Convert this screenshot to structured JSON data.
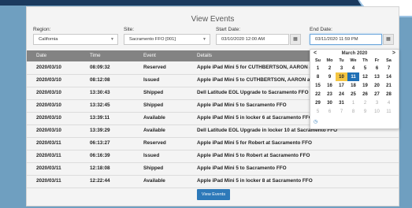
{
  "page": {
    "title": "View Events"
  },
  "filters": {
    "region_label": "Region:",
    "region_value": "California",
    "site_label": "Site:",
    "site_value": "Sacramento FFO [001]",
    "start_label": "Start Date:",
    "start_value": "03/10/2020 12:00 AM",
    "end_label": "End Date:",
    "end_value": "03/11/2020 11:59 PM"
  },
  "table": {
    "headers": [
      "Date",
      "Time",
      "Event",
      "Details"
    ],
    "rows": [
      [
        "2020/03/10",
        "08:09:32",
        "Reserved",
        "Apple iPad Mini 5 for CUTHBERTSON, AARON at Sacramento FFO"
      ],
      [
        "2020/03/10",
        "08:12:08",
        "Issued",
        "Apple iPad Mini 5 to CUTHBERTSON, AARON at Sacramento FFO"
      ],
      [
        "2020/03/10",
        "13:30:43",
        "Shipped",
        "Dell Latitude EOL Upgrade to Sacramento FFO"
      ],
      [
        "2020/03/10",
        "13:32:45",
        "Shipped",
        "Apple iPad Mini 5 to Sacramento FFO"
      ],
      [
        "2020/03/10",
        "13:39:11",
        "Available",
        "Apple iPad Mini 5 in locker 6 at Sacramento FFO"
      ],
      [
        "2020/03/10",
        "13:39:29",
        "Available",
        "Dell Latitude EOL Upgrade in locker 10 at Sacramento FFO"
      ],
      [
        "2020/03/11",
        "06:13:27",
        "Reserved",
        "Apple iPad Mini 5 for Robert at Sacramento FFO"
      ],
      [
        "2020/03/11",
        "06:16:39",
        "Issued",
        "Apple iPad Mini 5 to Robert at Sacramento FFO"
      ],
      [
        "2020/03/11",
        "12:18:08",
        "Shipped",
        "Apple iPad Mini 5 to Sacramento FFO"
      ],
      [
        "2020/03/11",
        "12:22:44",
        "Available",
        "Apple iPad Mini 5 in locker 8 at Sacramento FFO"
      ]
    ]
  },
  "calendar": {
    "month_label": "March 2020",
    "prev": "<",
    "next": ">",
    "dow": [
      "Su",
      "Mo",
      "Tu",
      "We",
      "Th",
      "Fr",
      "Sa"
    ],
    "weeks": [
      [
        "1",
        "2",
        "3",
        "4",
        "5",
        "6",
        "7"
      ],
      [
        "8",
        "9",
        "10",
        "11",
        "12",
        "13",
        "14"
      ],
      [
        "15",
        "16",
        "17",
        "18",
        "19",
        "20",
        "21"
      ],
      [
        "22",
        "23",
        "24",
        "25",
        "26",
        "27",
        "28"
      ],
      [
        "29",
        "30",
        "31",
        "1",
        "2",
        "3",
        "4"
      ],
      [
        "5",
        "6",
        "7",
        "8",
        "9",
        "10",
        "11"
      ]
    ],
    "selected_day": "11",
    "today_day": "10",
    "clock_icon": "clock-icon"
  },
  "actions": {
    "view_button": "View Events"
  },
  "colors": {
    "accent": "#2d79b9",
    "header_bg": "#838383",
    "today": "#f4c542",
    "selected": "#1f6fb5"
  }
}
